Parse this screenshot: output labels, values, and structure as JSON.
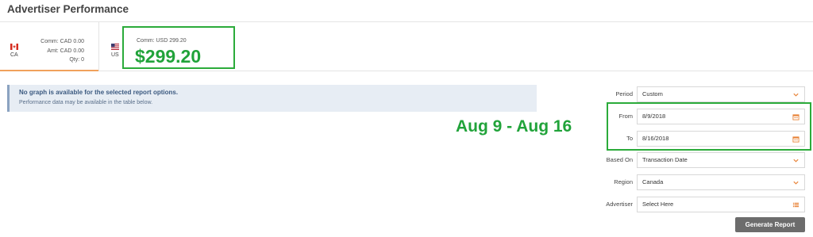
{
  "page_title": "Advertiser Performance",
  "tabs": {
    "ca": {
      "code": "CA",
      "comm": "Comm: CAD 0.00",
      "amt": "Amt: CAD 0.00",
      "qty": "Qty: 0"
    },
    "us": {
      "code": "US",
      "comm": "Comm: USD 299.20",
      "amount": "$299.20"
    }
  },
  "notice": {
    "title": "No graph is available for the selected report options.",
    "subtitle": "Performance data may be available in the table below."
  },
  "date_callout": "Aug 9 - Aug 16",
  "form": {
    "period": {
      "label": "Period",
      "value": "Custom"
    },
    "from": {
      "label": "From",
      "value": "8/9/2018"
    },
    "to": {
      "label": "To",
      "value": "8/16/2018"
    },
    "based_on": {
      "label": "Based On",
      "value": "Transaction Date"
    },
    "region": {
      "label": "Region",
      "value": "Canada"
    },
    "advertiser": {
      "label": "Advertiser",
      "value": "Select Here"
    },
    "generate_label": "Generate Report"
  },
  "colors": {
    "accent": "#f0a15c",
    "highlight": "#2bab3a",
    "notice_bg": "#e7edf4",
    "button_bg": "#6c6c6c"
  },
  "icons": {
    "dropdown": "chevron-down-icon",
    "calendar": "calendar-icon",
    "list": "list-icon"
  }
}
